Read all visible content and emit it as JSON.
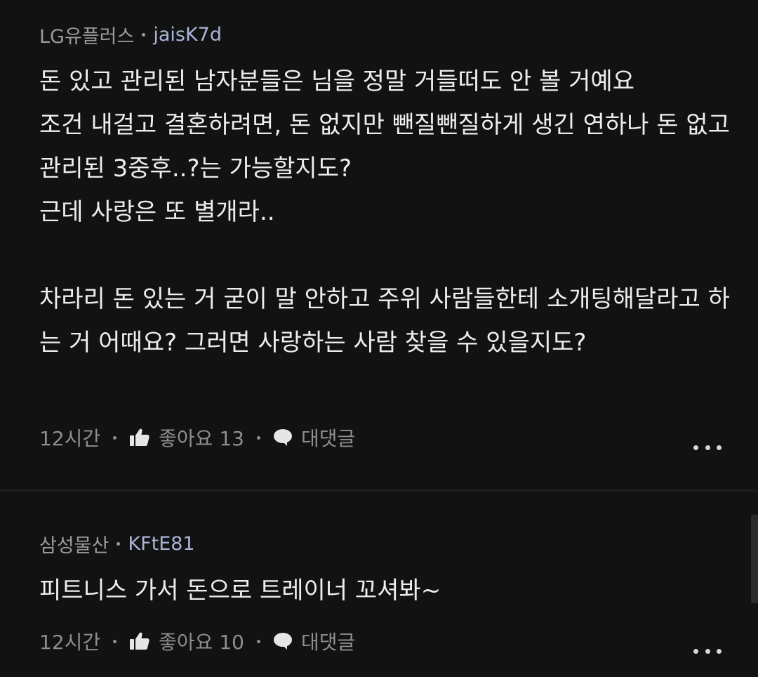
{
  "comments": [
    {
      "company": "LG유플러스",
      "nickname": "jaisK7d",
      "body": "돈 있고 관리된 남자분들은 님을 정말 거들떠도 안 볼 거예요\n조건 내걸고 결혼하려면, 돈 없지만 뺀질뺀질하게 생긴 연하나 돈 없고 관리된 3중후..?는 가능할지도?\n근데 사랑은 또 별개라..\n\n차라리 돈 있는 거 굳이 말 안하고 주위 사람들한테 소개팅해달라고 하는 거 어때요? 그러면 사랑하는 사람 찾을 수 있을지도?",
      "time": "12시간",
      "like_label": "좋아요 13",
      "reply_label": "대댓글"
    },
    {
      "company": "삼성물산",
      "nickname": "KFtE81",
      "body": "피트니스 가서 돈으로 트레이너 꼬셔봐~",
      "time": "12시간",
      "like_label": "좋아요 10",
      "reply_label": "대댓글"
    }
  ],
  "icons": {
    "like": "thumbs-up-icon",
    "reply": "speech-bubble-icon",
    "more": "more-dots-icon"
  },
  "colors": {
    "background": "#121212",
    "nickname": "#a9b4d6",
    "meta": "#9a9a9a",
    "body": "#ededed"
  }
}
